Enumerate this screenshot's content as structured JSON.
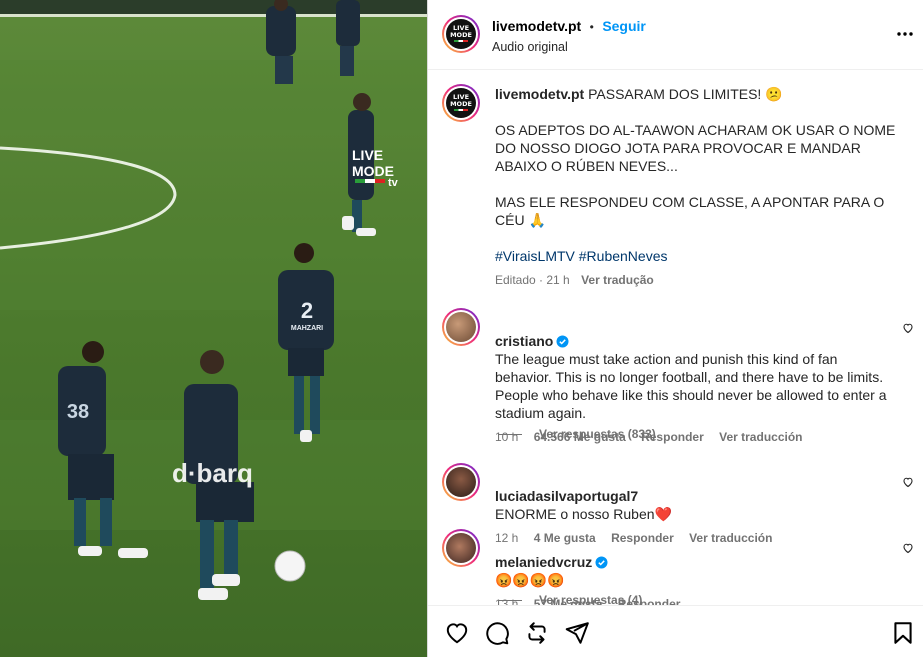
{
  "post": {
    "username": "livemodetv.pt",
    "follow_label": "Seguir",
    "dot": "•",
    "audio": "Audio original",
    "more_icon": "more-horizontal-icon",
    "logo_text": [
      "LIVE",
      "MODE",
      "tv"
    ]
  },
  "caption": {
    "username": "livemodetv.pt",
    "text": "PASSARAM DOS LIMITES! 😕\n\nOS ADEPTOS DO AL-TAAWON ACHARAM OK USAR O NOME DO NOSSO DIOGO JOTA PARA PROVOCAR E MANDAR ABAIXO O RÚBEN NEVES...\n\nMAS ELE RESPONDEU COM CLASSE, A APONTAR PARA O CÉU 🙏",
    "hashtags": "#ViraisLMTV #RubenNeves",
    "edited": "Editado · 21 h",
    "translate": "Ver tradução"
  },
  "comments": [
    {
      "username": "cristiano",
      "verified": true,
      "text": "The league must take action and punish this kind of fan behavior. This is no longer football, and there have to be limits. People who behave like this should never be allowed to enter a stadium again.",
      "time": "10 h",
      "likes": "64.566 Me gusta",
      "reply": "Responder",
      "translate": "Ver traducción",
      "replies": "Ver respuestas (833)"
    },
    {
      "username": "luciadasilvaportugal7",
      "verified": false,
      "text": "ENORME o nosso Ruben❤️",
      "time": "12 h",
      "likes": "4 Me gusta",
      "reply": "Responder",
      "translate": "Ver traducción"
    },
    {
      "username": "melaniedvcruz",
      "verified": true,
      "text": "😡😡😡😡",
      "time": "13 h",
      "likes": "57 Me gusta",
      "reply": "Responder",
      "replies": "Ver respuestas (4)"
    }
  ],
  "video_overlay": {
    "watermark_top": [
      "LIVE",
      "MODE",
      "tv"
    ],
    "sponsor": "d·barq",
    "jersey_numbers": [
      "2",
      "38"
    ],
    "jersey_name": "MAHZARI"
  },
  "icons": {
    "like": "heart-icon",
    "comment": "comment-icon",
    "repost": "repost-icon",
    "share": "share-icon",
    "save": "bookmark-icon"
  },
  "colors": {
    "link_blue": "#0095f6",
    "hashtag": "#00376b",
    "muted": "#737373",
    "pitch": "#4a7a2e"
  }
}
